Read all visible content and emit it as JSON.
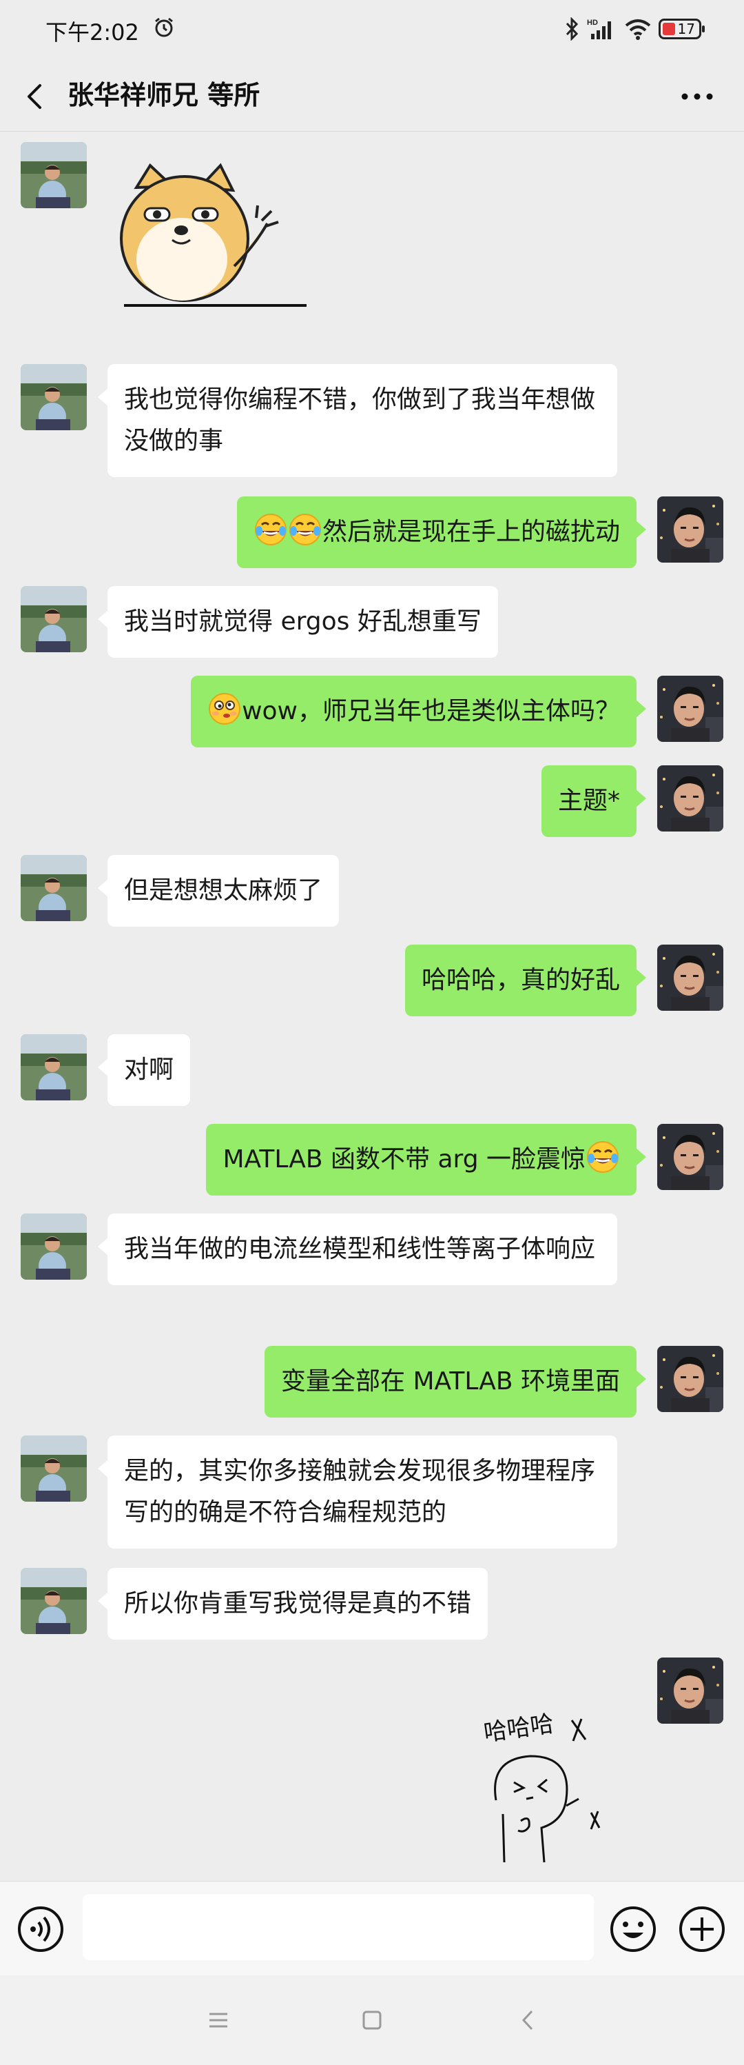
{
  "status_bar": {
    "time": "下午2:02",
    "battery": "17",
    "icons": [
      "alarm-icon",
      "bluetooth-icon",
      "hd-icon",
      "signal-icon",
      "wifi-icon",
      "battery-icon"
    ]
  },
  "header": {
    "title": "张华祥师兄 等所",
    "back_icon": "chevron-left-icon",
    "more_icon": "more-dots-icon"
  },
  "messages": [
    {
      "side": "left",
      "type": "sticker",
      "sticker": "shiba-dog-waving"
    },
    {
      "side": "left",
      "type": "text",
      "text": "我也觉得你编程不错，你做到了我当年想做没做的事"
    },
    {
      "side": "right",
      "type": "text",
      "text": "然后就是现在手上的磁扰动",
      "prefix_emoji": [
        "laugh-cry-emoji",
        "laugh-cry-emoji"
      ]
    },
    {
      "side": "left",
      "type": "text",
      "text": "我当时就觉得 ergos 好乱想重写"
    },
    {
      "side": "right",
      "type": "text",
      "text": "wow，师兄当年也是类似主体吗？",
      "prefix_emoji": [
        "dizzy-emoji"
      ]
    },
    {
      "side": "right",
      "type": "text",
      "text": "主题*"
    },
    {
      "side": "left",
      "type": "text",
      "text": "但是想想太麻烦了"
    },
    {
      "side": "right",
      "type": "text",
      "text": "哈哈哈，真的好乱"
    },
    {
      "side": "left",
      "type": "text",
      "text": "对啊"
    },
    {
      "side": "right",
      "type": "text",
      "text": "MATLAB 函数不带 arg 一脸震惊",
      "suffix_emoji": [
        "laugh-cry-emoji"
      ]
    },
    {
      "side": "left",
      "type": "text",
      "text": "我当年做的电流丝模型和线性等离子体响应"
    },
    {
      "side": "right",
      "type": "text",
      "text": "变量全部在 MATLAB 环境里面"
    },
    {
      "side": "left",
      "type": "text",
      "text": "是的，其实你多接触就会发现很多物理程序写的的确是不符合编程规范的"
    },
    {
      "side": "left",
      "type": "text",
      "text": "所以你肯重写我觉得是真的不错"
    },
    {
      "side": "right",
      "type": "sticker",
      "sticker": "doodle-laughing",
      "sticker_text": "哈哈哈"
    }
  ],
  "input_bar": {
    "voice_icon": "voice-icon",
    "emoji_icon": "emoji-icon",
    "plus_icon": "plus-icon",
    "value": ""
  },
  "system_nav": [
    "menu-icon",
    "home-icon",
    "back-icon"
  ],
  "colors": {
    "background": "#ededed",
    "bubble_self": "#95ec69",
    "bubble_other": "#ffffff"
  }
}
